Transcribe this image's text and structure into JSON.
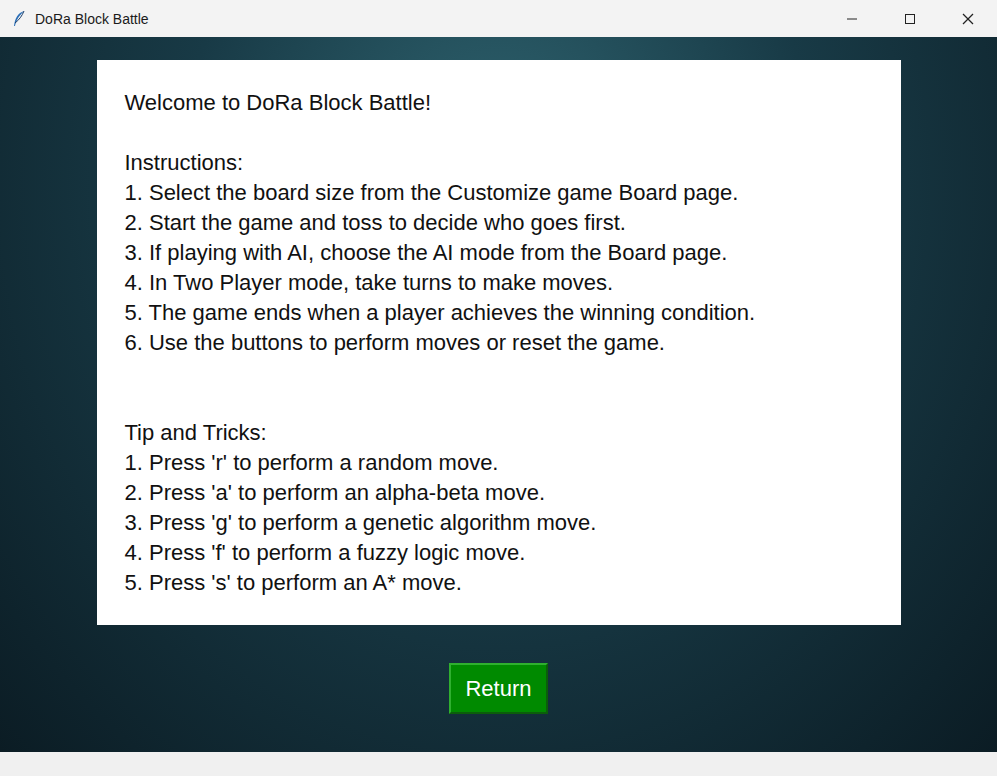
{
  "window": {
    "title": "DoRa Block Battle"
  },
  "panel": {
    "welcome": "Welcome to DoRa Block Battle!",
    "instructions": {
      "heading": "Instructions:",
      "items": [
        "1. Select the board size from the Customize game Board page.",
        "2. Start the game and toss to decide who goes first.",
        "3. If playing with AI, choose the AI mode from the Board page.",
        "4. In Two Player mode, take turns to make moves.",
        "5. The game ends when a player achieves the winning condition.",
        "6. Use the buttons to perform moves or reset the game."
      ]
    },
    "tips": {
      "heading": "Tip and Tricks:",
      "items": [
        "1. Press 'r' to perform a random move.",
        "2. Press 'a' to perform an alpha-beta move.",
        "3. Press 'g' to perform a genetic algorithm move.",
        "4. Press 'f' to perform a fuzzy logic move.",
        "5. Press 's' to perform an A* move."
      ]
    }
  },
  "buttons": [
    "Return"
  ]
}
